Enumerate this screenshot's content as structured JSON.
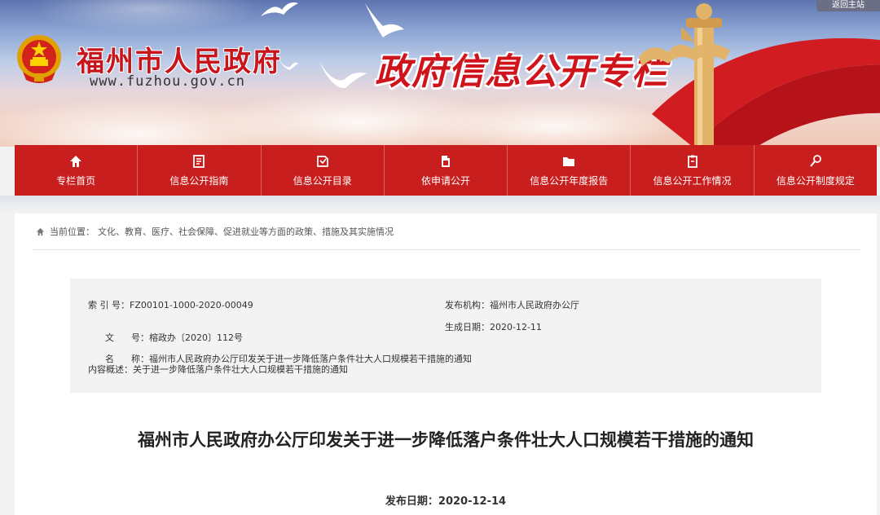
{
  "header": {
    "site_name": "福州市人民政府",
    "site_url": "www.fuzhou.gov.cn",
    "column_title": "政府信息公开专栏",
    "back_label": "返回主站"
  },
  "nav": {
    "items": [
      {
        "label": "专栏首页",
        "icon": "home-icon"
      },
      {
        "label": "信息公开指南",
        "icon": "guide-icon"
      },
      {
        "label": "信息公开目录",
        "icon": "catalog-icon"
      },
      {
        "label": "依申请公开",
        "icon": "document-icon"
      },
      {
        "label": "信息公开年度报告",
        "icon": "folder-icon"
      },
      {
        "label": "信息公开工作情况",
        "icon": "clipboard-icon"
      },
      {
        "label": "信息公开制度规定",
        "icon": "gavel-icon"
      }
    ]
  },
  "breadcrumb": {
    "prefix": "当前位置：",
    "path": "文化、教育、医疗、社会保障、促进就业等方面的政策、措施及其实施情况"
  },
  "meta": {
    "index_label": "索 引 号：",
    "index_value": "FZ00101-1000-2020-00049",
    "publisher_label": "发布机构：",
    "publisher_value": "福州市人民政府办公厅",
    "docno_label": "文      号：",
    "docno_value": "榕政办〔2020〕112号",
    "created_label": "生成日期：",
    "created_value": "2020-12-11",
    "name_label": "名      称：",
    "name_value": "福州市人民政府办公厅印发关于进一步降低落户条件壮大人口规模若干措施的通知",
    "summary_label": "内容概述：",
    "summary_value": "关于进一步降低落户条件壮大人口规模若干措施的通知"
  },
  "document": {
    "title": "福州市人民政府办公厅印发关于进一步降低落户条件壮大人口规模若干措施的通知",
    "date_label": "发布日期：",
    "date_value": "2020-12-14"
  },
  "colors": {
    "brand_red": "#c91e1e",
    "title_red": "#d0141c",
    "meta_bg": "#f3f3f3"
  }
}
